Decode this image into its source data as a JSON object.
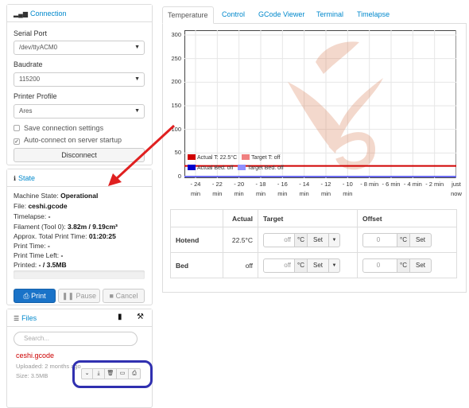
{
  "connection": {
    "title": "Connection",
    "serial_port_label": "Serial Port",
    "serial_port_value": "/dev/ttyACM0",
    "baudrate_label": "Baudrate",
    "baudrate_value": "115200",
    "profile_label": "Printer Profile",
    "profile_value": "Ares",
    "save_settings_label": "Save connection settings",
    "autoconnect_label": "Auto-connect on server startup",
    "disconnect_label": "Disconnect"
  },
  "state": {
    "title": "State",
    "machine_state_label": "Machine State:",
    "machine_state_value": "Operational",
    "file_label": "File:",
    "file_value": "ceshi.gcode",
    "timelapse_label": "Timelapse:",
    "timelapse_value": "-",
    "filament_label": "Filament (Tool 0):",
    "filament_value": "3.82m / 9.19cm³",
    "approx_label": "Approx. Total Print Time:",
    "approx_value": "01:20:25",
    "print_time_label": "Print Time:",
    "print_time_value": "-",
    "time_left_label": "Print Time Left:",
    "time_left_value": "-",
    "printed_label": "Printed:",
    "printed_value": "- / 3.5MB",
    "progress": 0,
    "print_label": "Print",
    "pause_label": "Pause",
    "cancel_label": "Cancel"
  },
  "files": {
    "title": "Files",
    "search_placeholder": "Search...",
    "items": [
      {
        "name": "ceshi.gcode",
        "uploaded": "Uploaded: 2 months ago",
        "size": "Size: 3.5MB"
      }
    ]
  },
  "tabs": [
    "Temperature",
    "Control",
    "GCode Viewer",
    "Terminal",
    "Timelapse"
  ],
  "chart_data": {
    "type": "line",
    "ylim": [
      0,
      300
    ],
    "yticks": [
      "300",
      "250",
      "200",
      "150",
      "100",
      "50",
      "0"
    ],
    "xticks": [
      [
        "- 24",
        "min"
      ],
      [
        "- 22",
        "min"
      ],
      [
        "- 20",
        "min"
      ],
      [
        "- 18",
        "min"
      ],
      [
        "- 16",
        "min"
      ],
      [
        "- 14",
        "min"
      ],
      [
        "- 12",
        "min"
      ],
      [
        "- 10",
        "min"
      ],
      [
        "- 8 min",
        ""
      ],
      [
        "- 6 min",
        ""
      ],
      [
        "- 4 min",
        ""
      ],
      [
        "- 2 min",
        ""
      ],
      [
        "just",
        "now"
      ]
    ],
    "series": [
      {
        "name": "Actual T: 22.5°C",
        "color": "#d00000",
        "values": [
          22.5,
          22.5
        ]
      },
      {
        "name": "Target T: off",
        "color": "#f08080",
        "values": [
          0,
          0
        ]
      },
      {
        "name": "Actual Bed: off",
        "color": "#0000cc",
        "values": [
          0,
          0
        ]
      },
      {
        "name": "Target Bed: off",
        "color": "#9090ff",
        "values": [
          0,
          0
        ]
      }
    ],
    "grid": true,
    "legend": "bottom-left"
  },
  "temp_table": {
    "headers": [
      "",
      "Actual",
      "Target",
      "Offset"
    ],
    "rows": [
      {
        "name": "Hotend",
        "actual": "22.5°C",
        "target_placeholder": "off",
        "offset_value": "0"
      },
      {
        "name": "Bed",
        "actual": "off",
        "target_placeholder": "off",
        "offset_value": "0"
      }
    ],
    "unit": "°C",
    "set_label": "Set"
  },
  "colors": {
    "link": "#0088cc",
    "primary": "#1a73c8",
    "annotation_red": "#e02020",
    "annotation_blue": "#3030b0"
  }
}
